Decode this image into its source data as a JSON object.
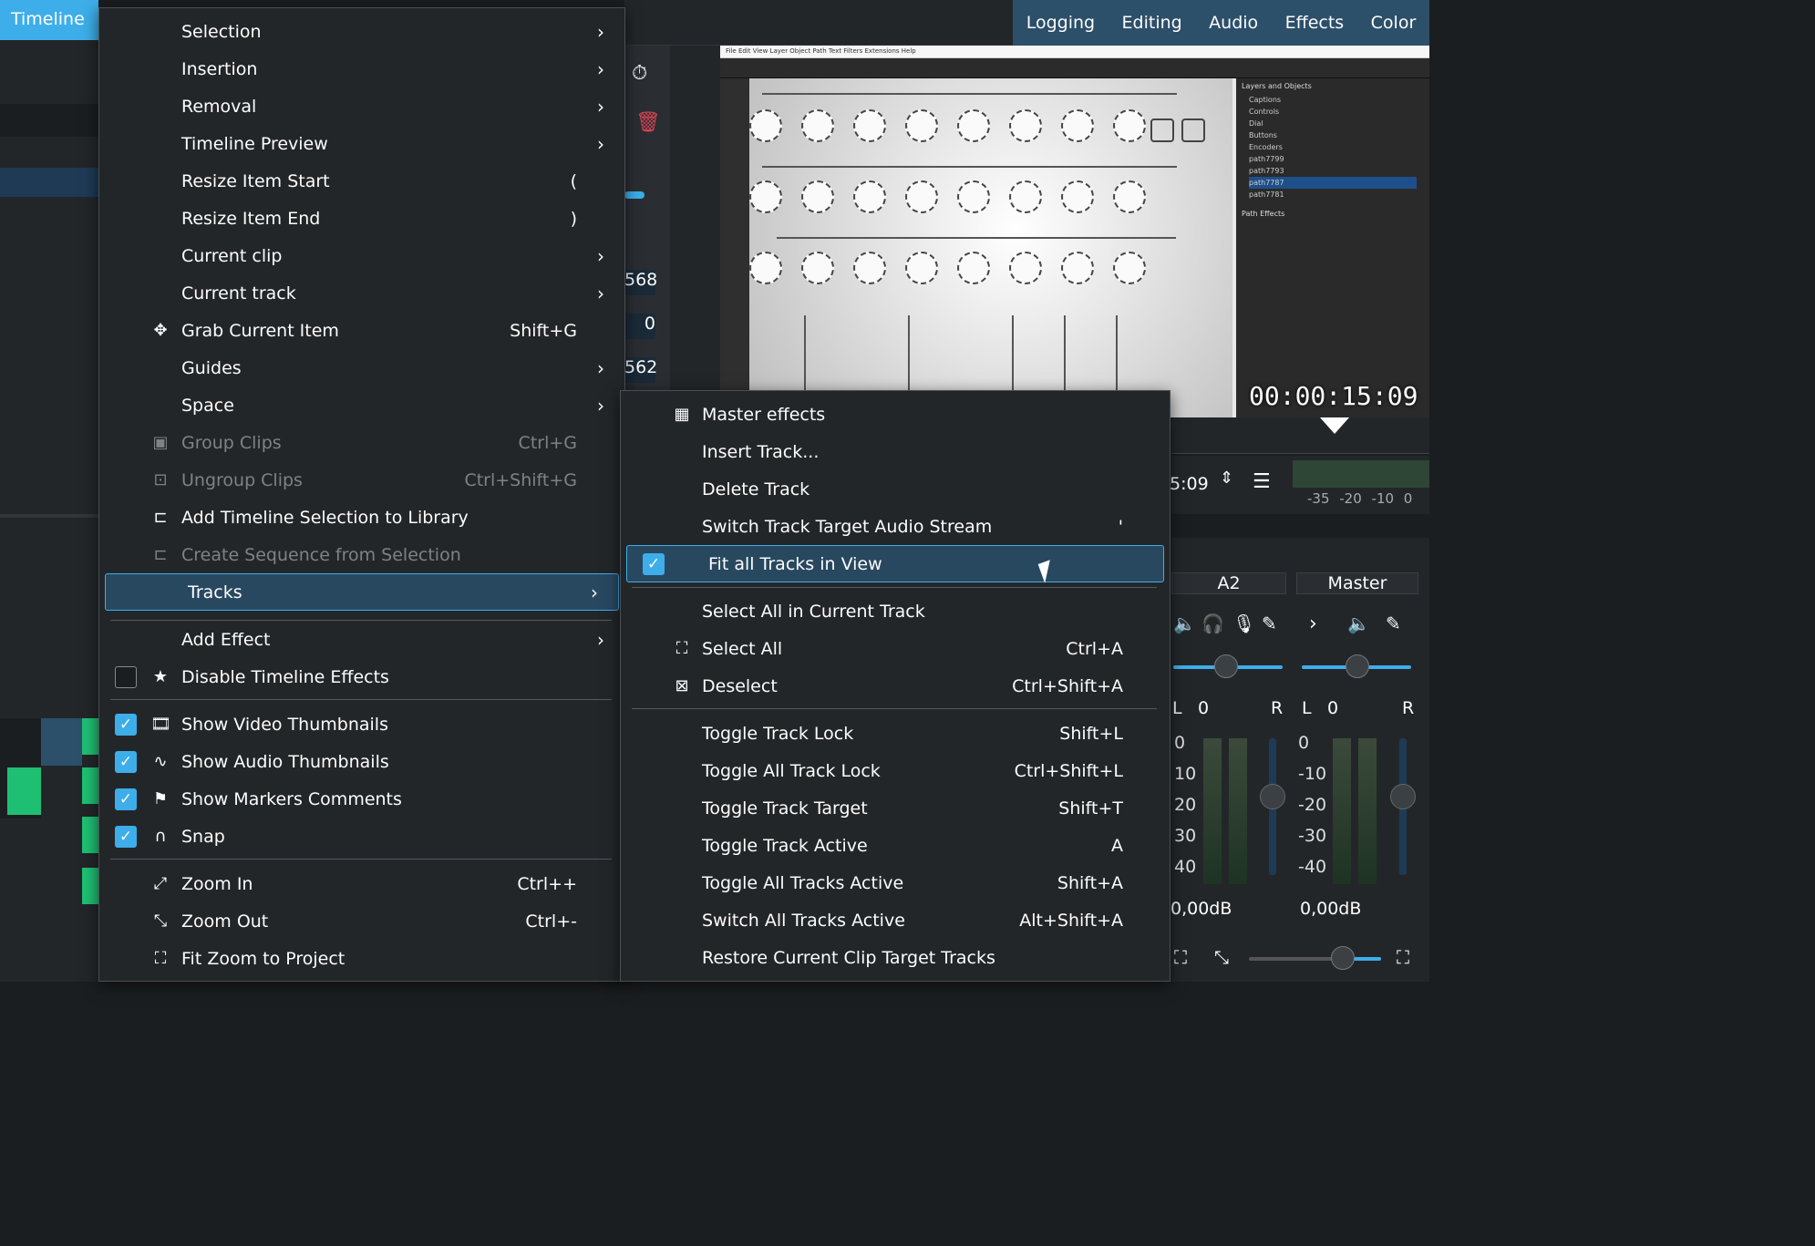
{
  "app": {
    "timeline_tab": "Timeline",
    "layouts": [
      "Logging",
      "Editing",
      "Audio",
      "Effects",
      "Color"
    ]
  },
  "monitor": {
    "timecode": "00:00:15:09",
    "transport_time": "5:09",
    "meter_scale": "-35 -20 -10 0",
    "side_values": [
      "568",
      "0",
      "562"
    ],
    "preview_menu": "File  Edit  View  Layer  Object  Path  Text  Filters  Extensions  Help",
    "preview_panels": [
      "Layers and Objects",
      "Path Effects"
    ],
    "preview_layers": [
      "Captions",
      "Controls",
      "Dial",
      "Buttons",
      "Encoders",
      "path7799",
      "path7793",
      "path7787",
      "path7781"
    ]
  },
  "mixer": {
    "channels": [
      {
        "name": "A2",
        "balance_l": "L",
        "balance_value": "0",
        "balance_r": "R",
        "gain": "0,00dB",
        "scale": [
          "0",
          "10",
          "20",
          "30",
          "40"
        ]
      },
      {
        "name": "Master",
        "balance_l": "L",
        "balance_value": "0",
        "balance_r": "R",
        "gain": "0,00dB",
        "scale": [
          "0",
          "-10",
          "-20",
          "-30",
          "-40"
        ]
      }
    ]
  },
  "main_menu": {
    "items": [
      {
        "label": "Selection",
        "submenu": true
      },
      {
        "label": "Insertion",
        "submenu": true
      },
      {
        "label": "Removal",
        "submenu": true
      },
      {
        "label": "Timeline Preview",
        "submenu": true
      },
      {
        "label": "Resize Item Start",
        "shortcut": "("
      },
      {
        "label": "Resize Item End",
        "shortcut": ")"
      },
      {
        "label": "Current clip",
        "submenu": true
      },
      {
        "label": "Current track",
        "submenu": true
      },
      {
        "label": "Grab Current Item",
        "shortcut": "Shift+G",
        "icon": "move-icon"
      },
      {
        "label": "Guides",
        "submenu": true
      },
      {
        "label": "Space",
        "submenu": true
      },
      {
        "label": "Group Clips",
        "shortcut": "Ctrl+G",
        "icon": "group-icon",
        "disabled": true
      },
      {
        "label": "Ungroup Clips",
        "shortcut": "Ctrl+Shift+G",
        "icon": "ungroup-icon",
        "disabled": true
      },
      {
        "label": "Add Timeline Selection to Library",
        "icon": "library-add-icon"
      },
      {
        "label": "Create Sequence from Selection",
        "icon": "sequence-icon",
        "disabled": true
      },
      {
        "label": "Tracks",
        "submenu": true,
        "highlighted": true
      },
      {
        "label": "Add Effect",
        "submenu": true
      },
      {
        "label": "Disable Timeline Effects",
        "icon": "star-icon",
        "checkbox": false
      },
      {
        "label": "Show Video Thumbnails",
        "icon": "film-icon",
        "checkbox": true
      },
      {
        "label": "Show Audio Thumbnails",
        "icon": "waveform-icon",
        "checkbox": true
      },
      {
        "label": "Show Markers Comments",
        "icon": "flag-icon",
        "checkbox": true
      },
      {
        "label": "Snap",
        "icon": "magnet-icon",
        "checkbox": true
      },
      {
        "label": "Zoom In",
        "shortcut": "Ctrl++",
        "icon": "zoom-in-icon"
      },
      {
        "label": "Zoom Out",
        "shortcut": "Ctrl+-",
        "icon": "zoom-out-icon"
      },
      {
        "label": "Fit Zoom to Project",
        "icon": "zoom-fit-icon"
      }
    ]
  },
  "tracks_menu": {
    "items": [
      {
        "label": "Master effects",
        "icon": "effects-icon"
      },
      {
        "label": "Insert Track..."
      },
      {
        "label": "Delete Track"
      },
      {
        "label": "Switch Track Target Audio Stream",
        "shortcut": "'"
      },
      {
        "label": "Fit all Tracks in View",
        "checkbox": true,
        "highlighted": true
      },
      {
        "label": "Select All in Current Track"
      },
      {
        "label": "Select All",
        "shortcut": "Ctrl+A",
        "icon": "select-all-icon"
      },
      {
        "label": "Deselect",
        "shortcut": "Ctrl+Shift+A",
        "icon": "deselect-icon"
      },
      {
        "label": "Toggle Track Lock",
        "shortcut": "Shift+L"
      },
      {
        "label": "Toggle All Track Lock",
        "shortcut": "Ctrl+Shift+L"
      },
      {
        "label": "Toggle Track Target",
        "shortcut": "Shift+T"
      },
      {
        "label": "Toggle Track Active",
        "shortcut": "A"
      },
      {
        "label": "Toggle All Tracks Active",
        "shortcut": "Shift+A"
      },
      {
        "label": "Switch All Tracks Active",
        "shortcut": "Alt+Shift+A"
      },
      {
        "label": "Restore Current Clip Target Tracks"
      }
    ]
  },
  "colors": {
    "accent": "#3daee9",
    "highlight": "#284860",
    "menu_bg": "#232629",
    "track_green": "#1fbf73"
  }
}
